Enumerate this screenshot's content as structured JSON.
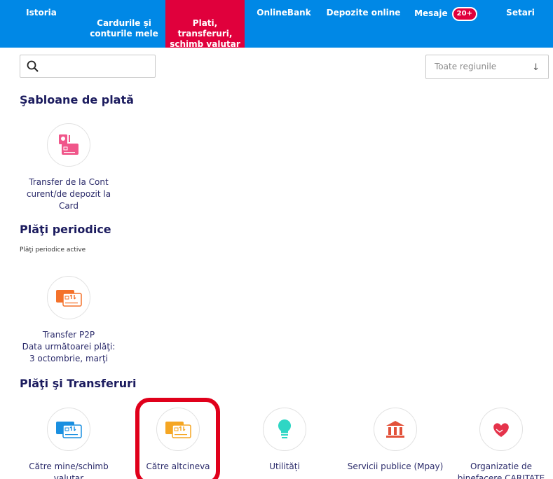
{
  "nav": {
    "items": [
      {
        "label": "Istoria"
      },
      {
        "label": "Cardurile și\nconturile mele"
      },
      {
        "label": "Plati,\ntransferuri,\nschimb valutar"
      },
      {
        "label": "OnlineBank"
      },
      {
        "label": "Depozite online"
      },
      {
        "label": "Mesaje",
        "badge": "20+"
      },
      {
        "label": "Setari"
      }
    ],
    "colors": {
      "bar": "#0088e6",
      "active": "#e0003c"
    }
  },
  "search": {
    "placeholder": ""
  },
  "region": {
    "value": "Toate regiunile",
    "arrow": "↓"
  },
  "sections": {
    "templates": {
      "title": "Şabloane de plată",
      "items": [
        {
          "label": "Transfer de la Cont curent/de depozit la Card",
          "icon": "account-to-card-icon"
        }
      ]
    },
    "periodic": {
      "title": "Plăţi periodice",
      "subtitle": "Plăţi periodice active",
      "items": [
        {
          "label": "Transfer P2P\nData următoarei plăţi: 3 octombrie, marţi",
          "icon": "p2p-card-icon"
        }
      ]
    },
    "transfers": {
      "title": "Plăţi şi Transferuri",
      "items": [
        {
          "label": "Către mine/schimb valutar",
          "icon": "own-cards-icon"
        },
        {
          "label": "Către altcineva",
          "icon": "other-person-card-icon"
        },
        {
          "label": "Utilități",
          "icon": "lightbulb-icon"
        },
        {
          "label": "Servicii publice (Mpay)",
          "icon": "bank-building-icon"
        },
        {
          "label": "Organizatie de binefacere CARITATE VB",
          "icon": "heart-hands-icon"
        }
      ]
    }
  }
}
